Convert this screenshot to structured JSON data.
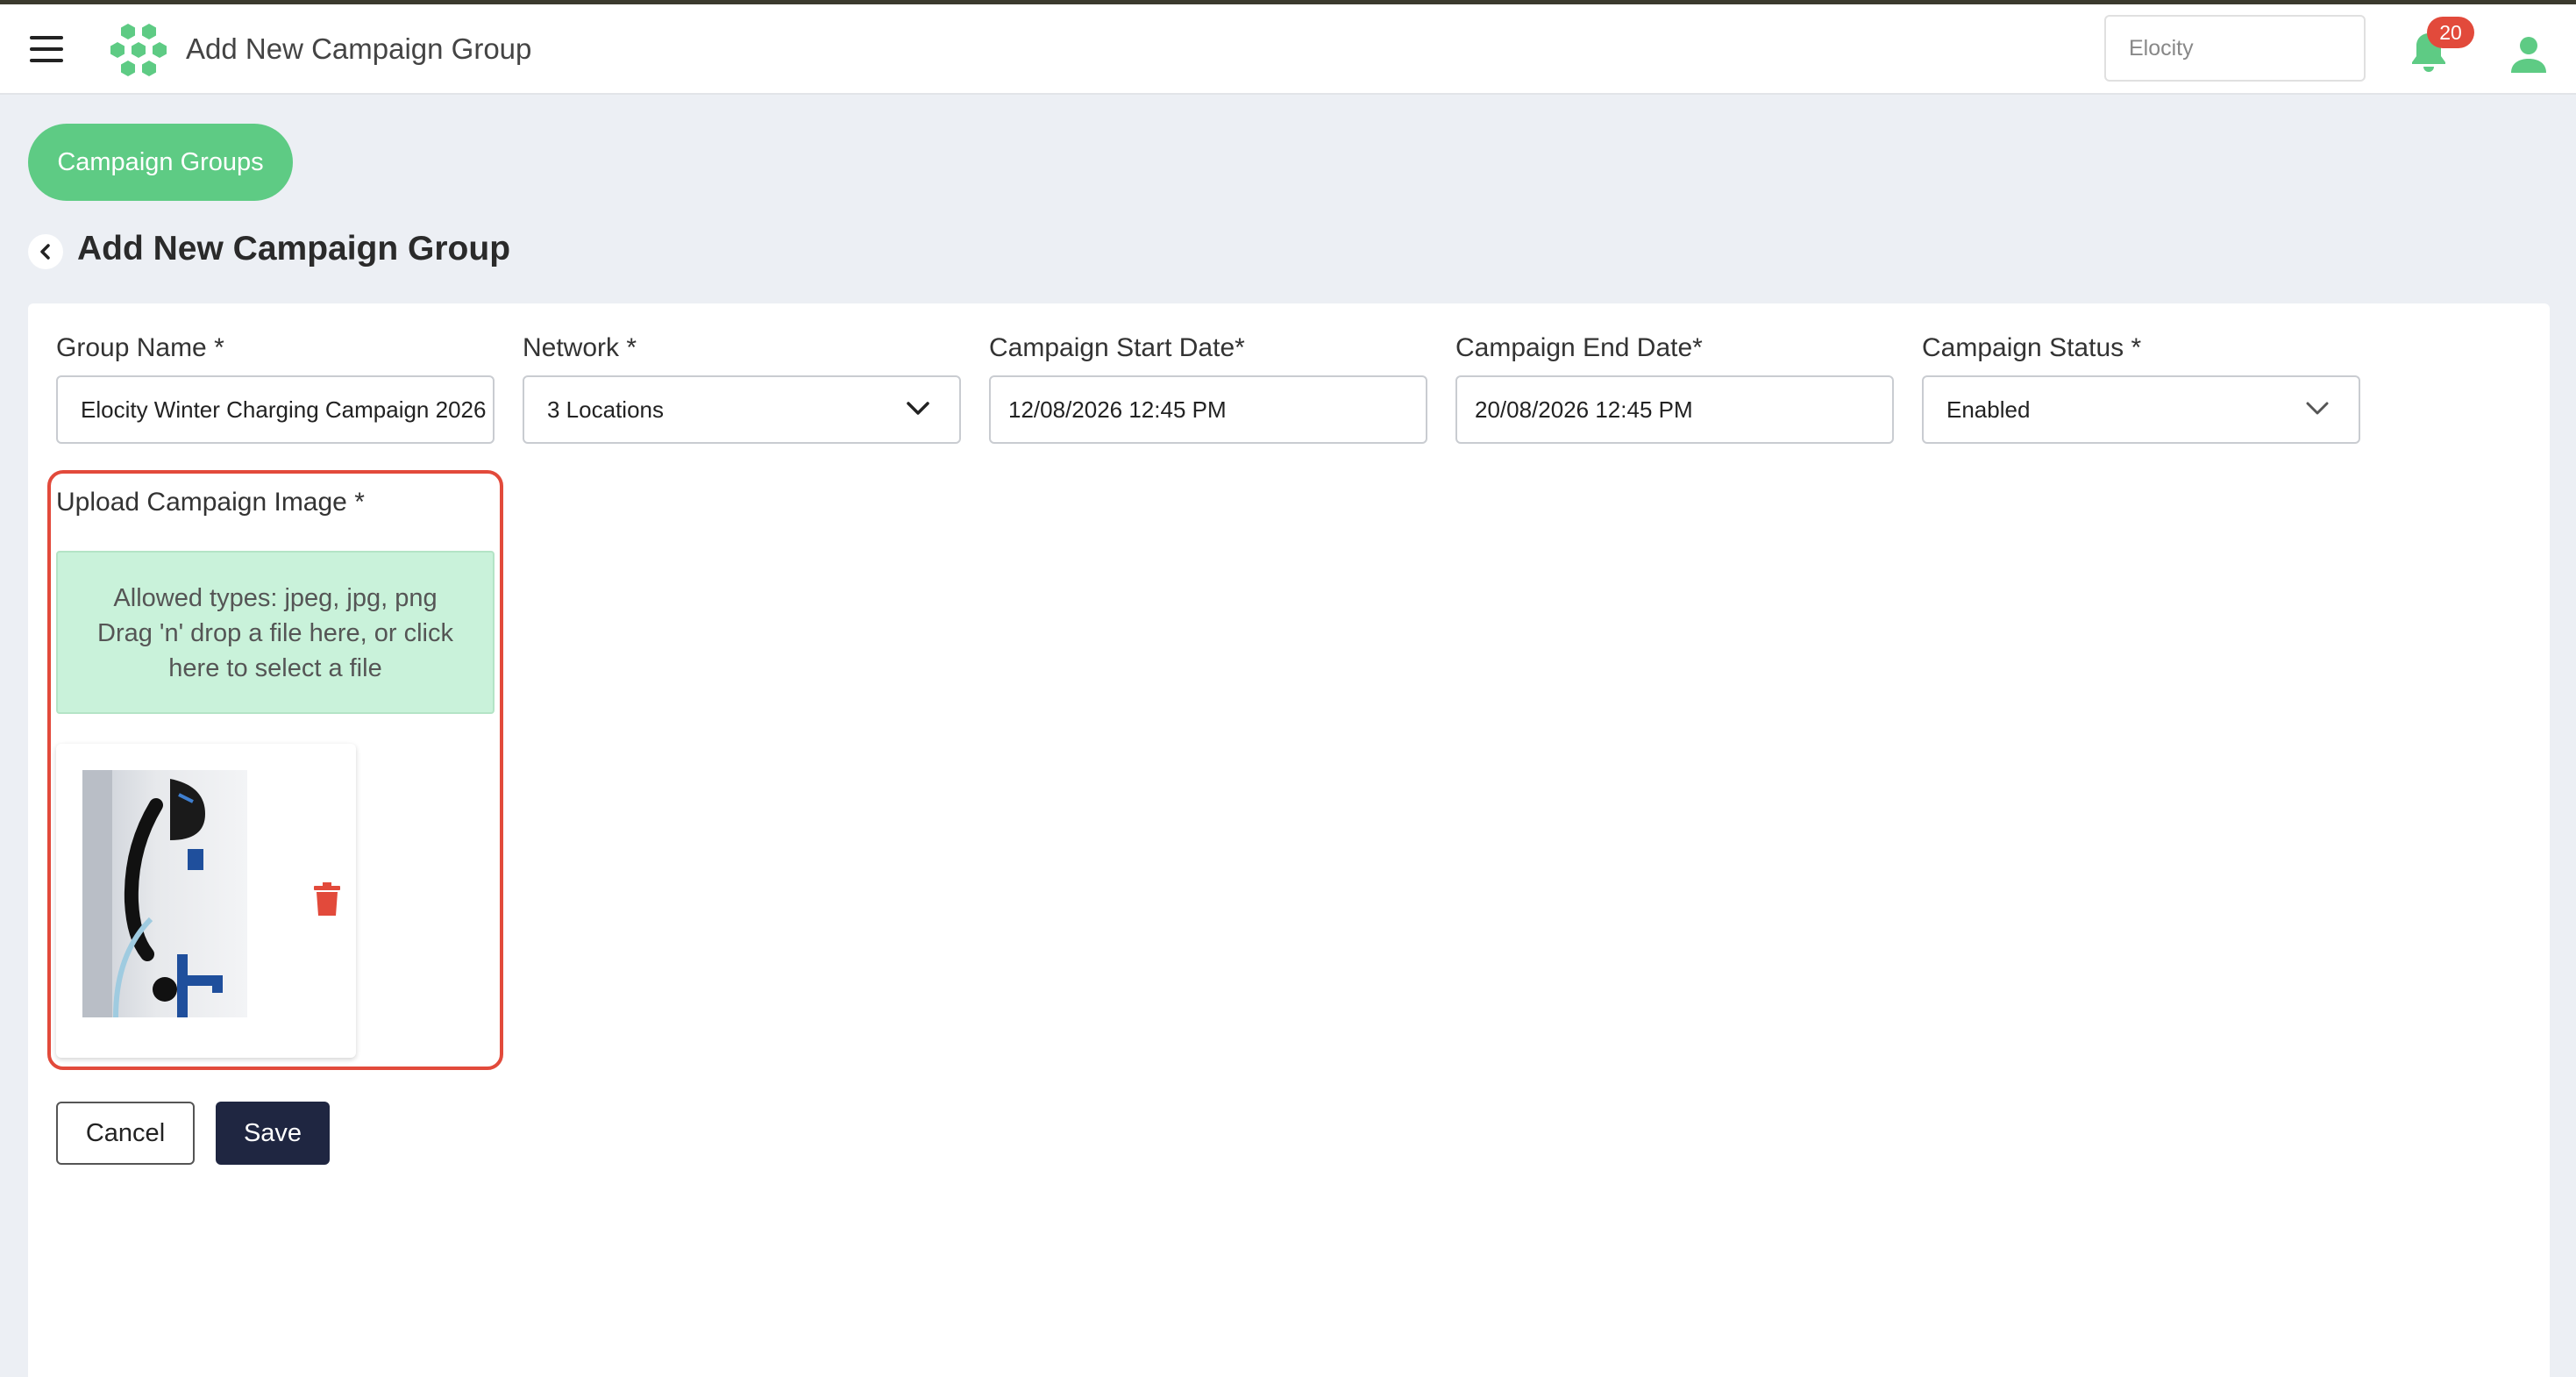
{
  "header": {
    "title": "Add New Campaign Group",
    "company": "Elocity",
    "notification_count": "20",
    "brand_color": "#5ecb84"
  },
  "breadcrumb": {
    "label": "Campaign Groups"
  },
  "page": {
    "title": "Add New Campaign Group"
  },
  "form": {
    "group_name": {
      "label": "Group Name *",
      "value": "Elocity Winter Charging Campaign 2026"
    },
    "network": {
      "label": "Network *",
      "value": "3 Locations"
    },
    "start_date": {
      "label": "Campaign Start Date*",
      "value": "12/08/2026 12:45 PM"
    },
    "end_date": {
      "label": "Campaign End Date*",
      "value": "20/08/2026 12:45 PM"
    },
    "status": {
      "label": "Campaign Status *",
      "value": "Enabled"
    },
    "upload": {
      "label": "Upload Campaign Image *",
      "hint_line1": "Allowed types: jpeg, jpg, png",
      "hint_line2": "Drag 'n' drop a file here, or click",
      "hint_line3": "here to select a file"
    }
  },
  "actions": {
    "cancel": "Cancel",
    "save": "Save"
  },
  "icons": [
    "menu-icon",
    "logo-icon",
    "bell-icon",
    "user-icon",
    "chevron-left-icon",
    "chevron-down-icon",
    "trash-icon"
  ]
}
